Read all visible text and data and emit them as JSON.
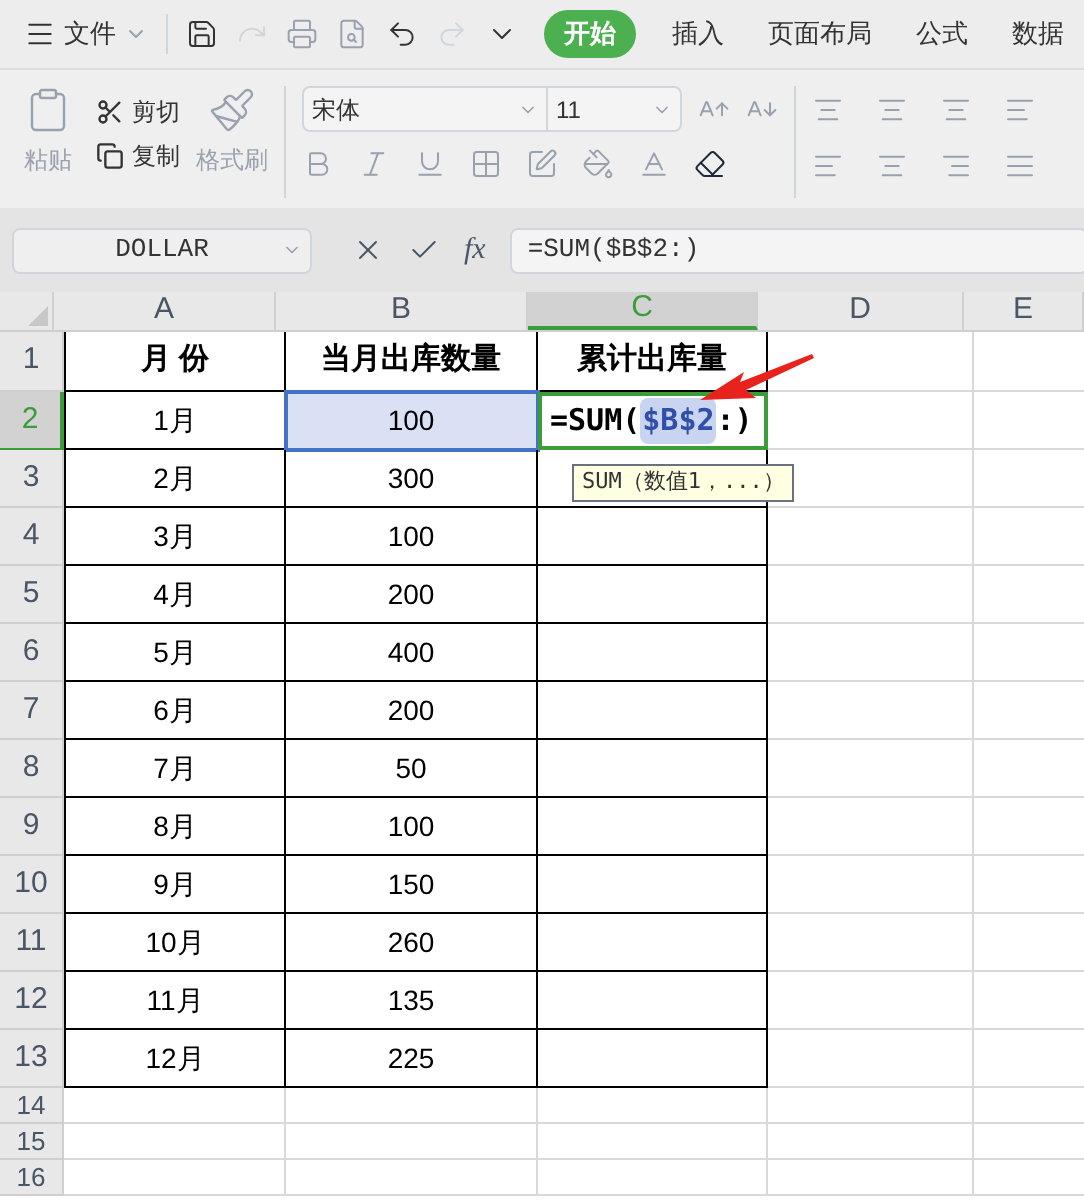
{
  "menu": {
    "file_label": "文件",
    "tabs": [
      {
        "label": "开始",
        "selected": true
      },
      {
        "label": "插入",
        "selected": false
      },
      {
        "label": "页面布局",
        "selected": false
      },
      {
        "label": "公式",
        "selected": false
      },
      {
        "label": "数据",
        "selected": false
      }
    ]
  },
  "ribbon": {
    "paste": "粘贴",
    "cut": "剪切",
    "copy": "复制",
    "format_painter": "格式刷",
    "font": "宋体",
    "size": "11"
  },
  "formula_bar": {
    "name_box": "DOLLAR",
    "fx": "fx",
    "formula": "=SUM($B$2:)"
  },
  "sheet": {
    "columns": [
      {
        "label": "A",
        "selected": false
      },
      {
        "label": "B",
        "selected": false
      },
      {
        "label": "C",
        "selected": true
      },
      {
        "label": "D",
        "selected": false
      },
      {
        "label": "E",
        "selected": false
      }
    ],
    "rows": [
      {
        "number": "1",
        "selected": false,
        "cells": [
          "月  份",
          "当月出库数量",
          "累计出库量"
        ]
      },
      {
        "number": "2",
        "selected": true,
        "cells": [
          "1月",
          "100",
          ""
        ]
      },
      {
        "number": "3",
        "selected": false,
        "cells": [
          "2月",
          "300",
          ""
        ]
      },
      {
        "number": "4",
        "selected": false,
        "cells": [
          "3月",
          "100",
          ""
        ]
      },
      {
        "number": "5",
        "selected": false,
        "cells": [
          "4月",
          "200",
          ""
        ]
      },
      {
        "number": "6",
        "selected": false,
        "cells": [
          "5月",
          "400",
          ""
        ]
      },
      {
        "number": "7",
        "selected": false,
        "cells": [
          "6月",
          "200",
          ""
        ]
      },
      {
        "number": "8",
        "selected": false,
        "cells": [
          "7月",
          "50",
          ""
        ]
      },
      {
        "number": "9",
        "selected": false,
        "cells": [
          "8月",
          "100",
          ""
        ]
      },
      {
        "number": "10",
        "selected": false,
        "cells": [
          "9月",
          "150",
          ""
        ]
      },
      {
        "number": "11",
        "selected": false,
        "cells": [
          "10月",
          "260",
          ""
        ]
      },
      {
        "number": "12",
        "selected": false,
        "cells": [
          "11月",
          "135",
          ""
        ]
      },
      {
        "number": "13",
        "selected": false,
        "cells": [
          "12月",
          "225",
          ""
        ]
      }
    ],
    "empty_rows": [
      "14",
      "15",
      "16"
    ],
    "editing": {
      "prefix": "=SUM(",
      "reference": "$B$2",
      "suffix": ":)"
    },
    "tooltip": "SUM（数值1，...）"
  }
}
